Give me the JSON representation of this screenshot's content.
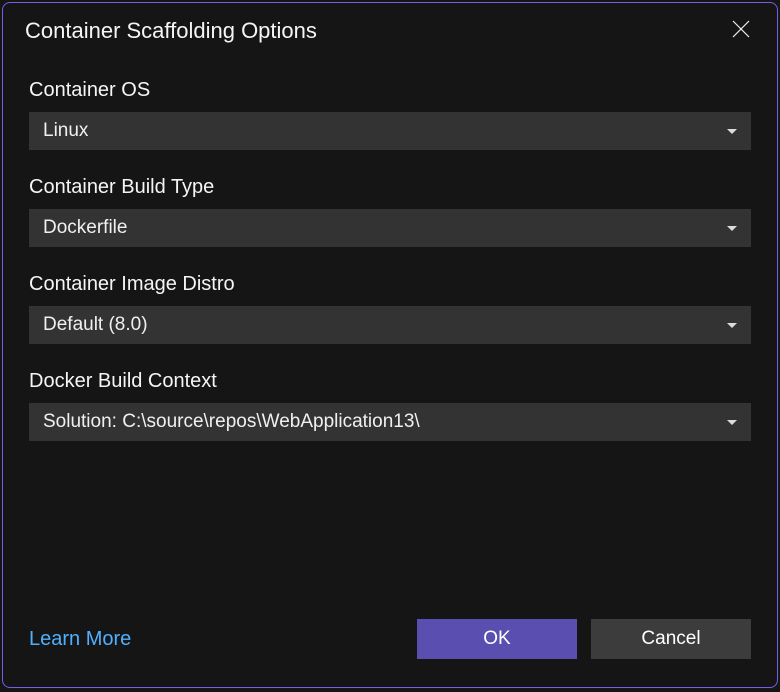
{
  "title": "Container Scaffolding Options",
  "fields": {
    "containerOs": {
      "label": "Container OS",
      "value": "Linux"
    },
    "buildType": {
      "label": "Container Build Type",
      "value": "Dockerfile"
    },
    "imageDistro": {
      "label": "Container Image Distro",
      "value": "Default (8.0)"
    },
    "buildContext": {
      "label": "Docker Build Context",
      "value": "Solution: C:\\source\\repos\\WebApplication13\\"
    }
  },
  "footer": {
    "learnMore": "Learn More",
    "ok": "OK",
    "cancel": "Cancel"
  }
}
